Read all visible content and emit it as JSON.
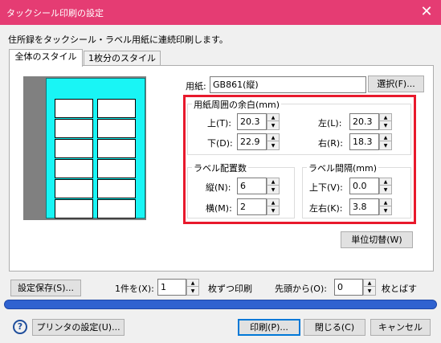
{
  "window": {
    "title": "タックシール印刷の設定",
    "close_icon": "close-icon"
  },
  "description": "住所録をタックシール・ラベル用紙に連続印刷します。",
  "tabs": [
    {
      "label": "全体のスタイル",
      "active": true
    },
    {
      "label": "1枚分のスタイル",
      "active": false
    }
  ],
  "paper": {
    "label": "用紙:",
    "value": "GB861(縦)",
    "select_button": "選択(F)..."
  },
  "margins": {
    "title": "用紙周囲の余白(mm)",
    "top": {
      "label": "上(T):",
      "value": "20.3"
    },
    "bottom": {
      "label": "下(D):",
      "value": "22.9"
    },
    "left": {
      "label": "左(L):",
      "value": "20.3"
    },
    "right": {
      "label": "右(R):",
      "value": "18.3"
    }
  },
  "layout": {
    "title": "ラベル配置数",
    "rows": {
      "label": "縦(N):",
      "value": "6"
    },
    "cols": {
      "label": "横(M):",
      "value": "2"
    }
  },
  "spacing": {
    "title": "ラベル間隔(mm)",
    "vertical": {
      "label": "上下(V):",
      "value": "0.0"
    },
    "horizontal": {
      "label": "左右(K):",
      "value": "3.8"
    }
  },
  "unit_button": "単位切替(W)",
  "save_settings_button": "設定保存(S)...",
  "copies": {
    "label": "1件を(X):",
    "value": "1",
    "suffix": "枚ずつ印刷"
  },
  "skip": {
    "label": "先頭から(O):",
    "value": "0",
    "suffix": "枚とばす"
  },
  "footer": {
    "help_icon": "?",
    "printer_button": "プリンタの設定(U)...",
    "print_button": "印刷(P)...",
    "close_button": "閉じる(C)",
    "cancel_button": "キャンセル"
  },
  "colors": {
    "titlebar": "#e53c73",
    "sheet": "#19f5f5",
    "highlight": "#e8192c",
    "progress": "#2f62d0"
  }
}
